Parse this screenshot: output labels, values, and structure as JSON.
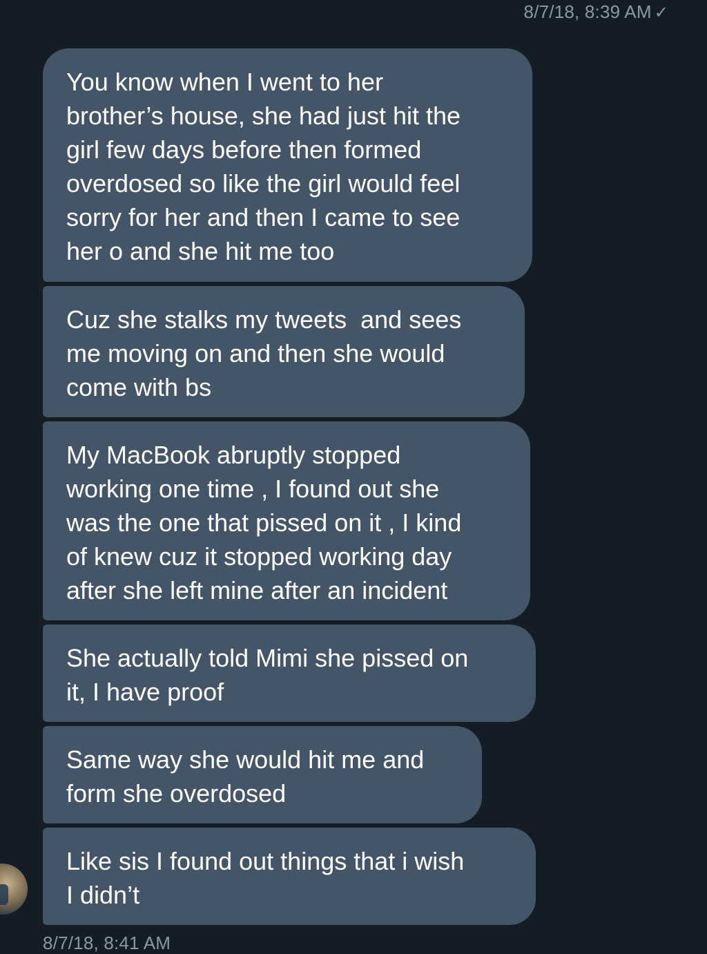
{
  "header": {
    "timestamp": "8/7/18, 8:39 AM",
    "check_glyph": "✓"
  },
  "messages": [
    {
      "text": "You know when I went to her\nbrother’s house, she had just hit the\ngirl few days before then formed\noverdosed so like the girl would feel\nsorry for her and then I came to see\nher o and she hit me too"
    },
    {
      "text": "Cuz she stalks my tweets  and sees\nme moving on and then she would\ncome with bs"
    },
    {
      "text": "My MacBook abruptly stopped\nworking one time , I found out she\nwas the one that pissed on it , I kind\nof knew cuz it stopped working day\nafter she left mine after an incident"
    },
    {
      "text": "She actually told Mimi she pissed on\nit, I have proof"
    },
    {
      "text": "Same way she would hit me and\nform she overdosed"
    },
    {
      "text": "Like sis I found out things that i wish\nI didn’t"
    }
  ],
  "footer": {
    "partial_timestamp": "8/7/18, 8:41 AM"
  },
  "colors": {
    "background": "#141d26",
    "bubble": "#435566",
    "meta_text": "#8899a6"
  }
}
